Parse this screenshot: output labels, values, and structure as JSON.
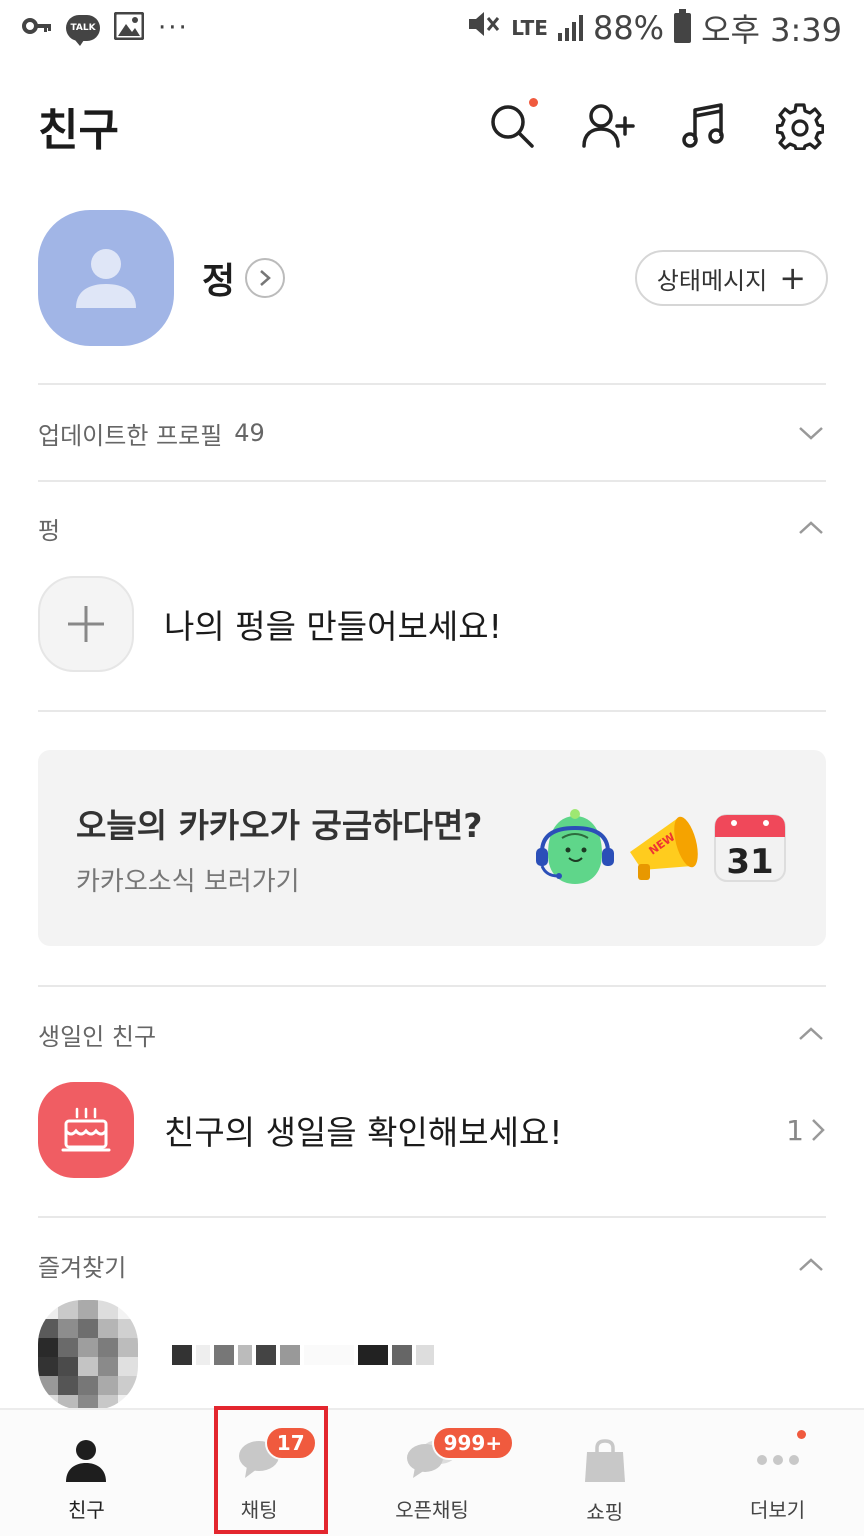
{
  "status_bar": {
    "talk_icon_text": "TALK",
    "dots": "···",
    "network": "LTE",
    "battery": "88%",
    "time": "오후 3:39"
  },
  "header": {
    "title": "친구"
  },
  "profile": {
    "name": "정",
    "status_button_label": "상태메시지"
  },
  "updated_profiles": {
    "label": "업데이트한 프로필",
    "count": "49"
  },
  "pung": {
    "section_label": "펑",
    "create_text": "나의 펑을 만들어보세요!"
  },
  "banner": {
    "title": "오늘의 카카오가 궁금하다면?",
    "subtitle": "카카오소식 보러가기",
    "megaphone_text": "NEW",
    "calendar_text": "31"
  },
  "birthday": {
    "section_label": "생일인 친구",
    "text": "친구의 생일을 확인해보세요!",
    "count": "1"
  },
  "favorites": {
    "section_label": "즐겨찾기"
  },
  "bottom_nav": {
    "items": [
      {
        "label": "친구",
        "icon": "person-icon"
      },
      {
        "label": "채팅",
        "icon": "chat-bubble-icon",
        "badge": "17"
      },
      {
        "label": "오픈채팅",
        "icon": "open-chat-icon",
        "badge": "999+"
      },
      {
        "label": "쇼핑",
        "icon": "shopping-bag-icon"
      },
      {
        "label": "더보기",
        "icon": "more-dots-icon"
      }
    ]
  },
  "colors": {
    "accent_red": "#f05a3e",
    "avatar_blue": "#a1b5e6",
    "birthday_red": "#f05d63",
    "highlight": "#e3262e"
  }
}
